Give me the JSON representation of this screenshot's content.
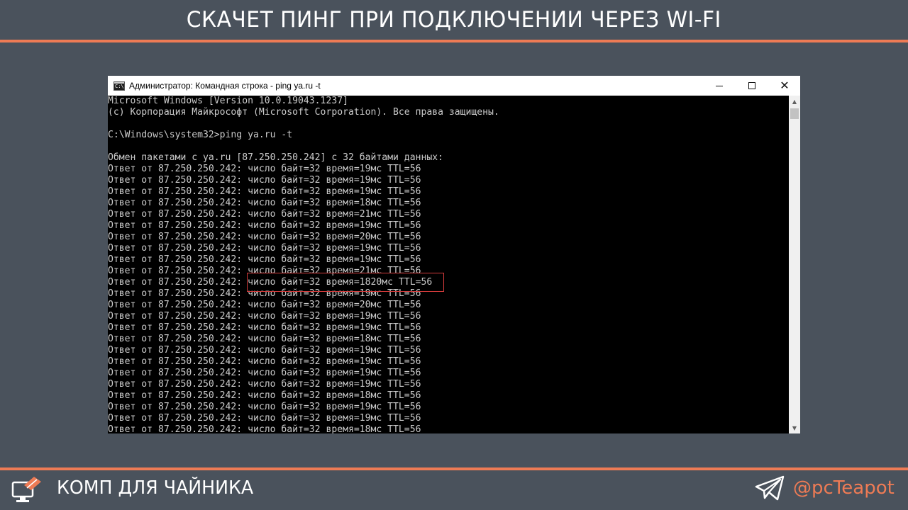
{
  "header": {
    "title": "СКАЧЕТ ПИНГ ПРИ ПОДКЛЮЧЕНИИ ЧЕРЕЗ WI-FI"
  },
  "window": {
    "title": "Администратор: Командная строка - ping  ya.ru -t",
    "controls": {
      "minimize": "minimize",
      "maximize": "maximize",
      "close": "✕"
    },
    "console_lines": [
      "Microsoft Windows [Version 10.0.19043.1237]",
      "(c) Корпорация Майкрософт (Microsoft Corporation). Все права защищены.",
      "",
      "C:\\Windows\\system32>ping ya.ru -t",
      "",
      "Обмен пакетами с ya.ru [87.250.250.242] с 32 байтами данных:",
      "Ответ от 87.250.250.242: число байт=32 время=19мс TTL=56",
      "Ответ от 87.250.250.242: число байт=32 время=19мс TTL=56",
      "Ответ от 87.250.250.242: число байт=32 время=19мс TTL=56",
      "Ответ от 87.250.250.242: число байт=32 время=18мс TTL=56",
      "Ответ от 87.250.250.242: число байт=32 время=21мс TTL=56",
      "Ответ от 87.250.250.242: число байт=32 время=19мс TTL=56",
      "Ответ от 87.250.250.242: число байт=32 время=20мс TTL=56",
      "Ответ от 87.250.250.242: число байт=32 время=19мс TTL=56",
      "Ответ от 87.250.250.242: число байт=32 время=19мс TTL=56",
      "Ответ от 87.250.250.242: число байт=32 время=21мс TTL=56",
      "Ответ от 87.250.250.242: число байт=32 время=1820мс TTL=56",
      "Ответ от 87.250.250.242: число байт=32 время=19мс TTL=56",
      "Ответ от 87.250.250.242: число байт=32 время=20мс TTL=56",
      "Ответ от 87.250.250.242: число байт=32 время=19мс TTL=56",
      "Ответ от 87.250.250.242: число байт=32 время=19мс TTL=56",
      "Ответ от 87.250.250.242: число байт=32 время=18мс TTL=56",
      "Ответ от 87.250.250.242: число байт=32 время=19мс TTL=56",
      "Ответ от 87.250.250.242: число байт=32 время=19мс TTL=56",
      "Ответ от 87.250.250.242: число байт=32 время=19мс TTL=56",
      "Ответ от 87.250.250.242: число байт=32 время=19мс TTL=56",
      "Ответ от 87.250.250.242: число байт=32 время=18мс TTL=56",
      "Ответ от 87.250.250.242: число байт=32 время=19мс TTL=56",
      "Ответ от 87.250.250.242: число байт=32 время=19мс TTL=56",
      "Ответ от 87.250.250.242: число байт=32 время=18мс TTL=56"
    ]
  },
  "footer": {
    "brand": "КОМП ДЛЯ ЧАЙНИКА",
    "handle": "@pcTeapot"
  },
  "colors": {
    "background": "#4a525c",
    "accent": "#ee7b55",
    "highlight": "#d33b3b"
  }
}
